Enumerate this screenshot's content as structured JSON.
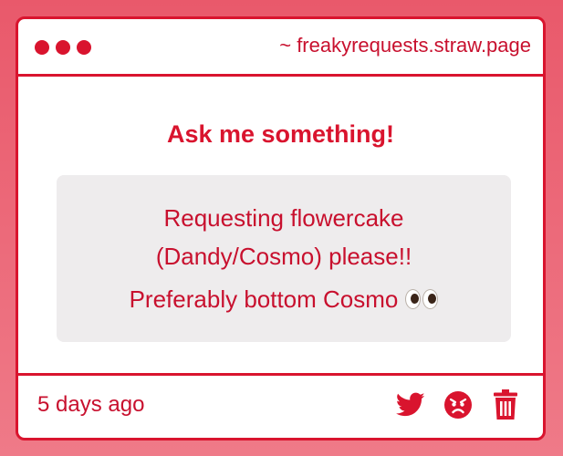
{
  "window": {
    "url": "~ freakyrequests.straw.page"
  },
  "main": {
    "heading": "Ask me something!",
    "message": {
      "line1": "Requesting flowercake",
      "line2": "(Dandy/Cosmo) please!!",
      "line3": "Preferably bottom Cosmo",
      "emoji": "eyes-emoji"
    }
  },
  "footer": {
    "timestamp": "5 days ago",
    "actions": [
      {
        "icon": "twitter-icon"
      },
      {
        "icon": "angry-face-icon"
      },
      {
        "icon": "trash-icon"
      }
    ]
  },
  "colors": {
    "accent": "#d9142e",
    "text": "#c8102e",
    "message_bg": "#eeeced",
    "background": "#e9596b"
  }
}
